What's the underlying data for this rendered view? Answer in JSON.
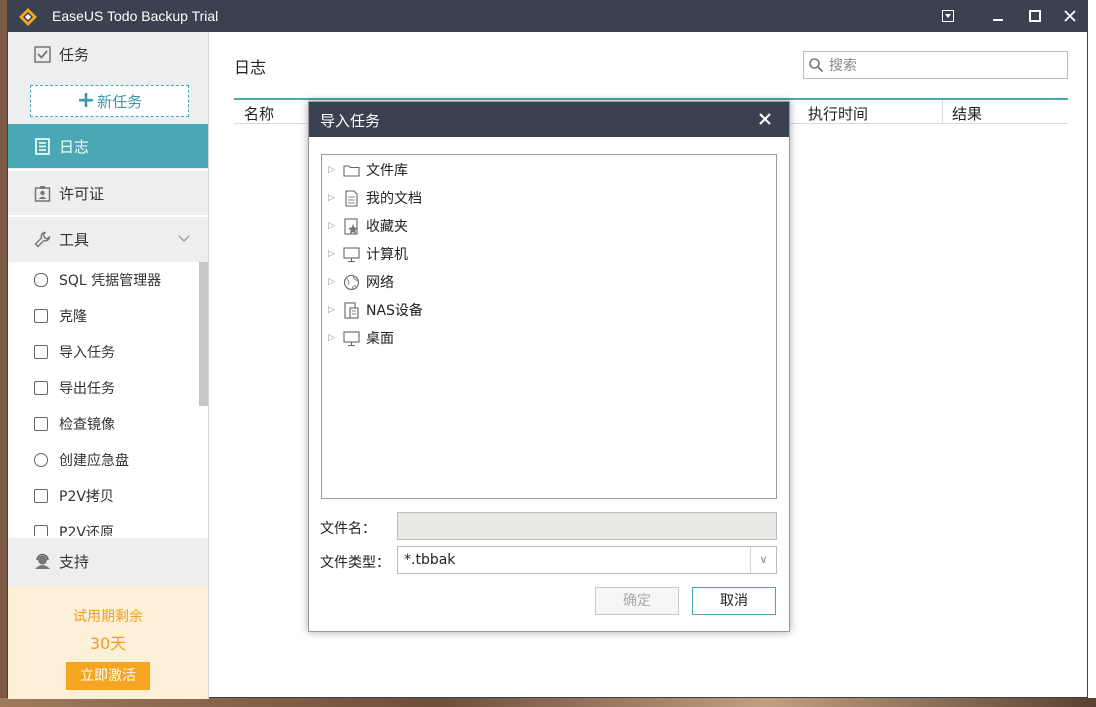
{
  "window": {
    "title": "EaseUS Todo Backup Trial"
  },
  "sidebar": {
    "tasks_label": "任务",
    "new_task_label": "新任务",
    "log_label": "日志",
    "license_label": "许可证",
    "tools_label": "工具",
    "tools": [
      {
        "label": "SQL 凭据管理器"
      },
      {
        "label": "克隆"
      },
      {
        "label": "导入任务"
      },
      {
        "label": "导出任务"
      },
      {
        "label": "检查镜像"
      },
      {
        "label": "创建应急盘"
      },
      {
        "label": "P2V拷贝"
      },
      {
        "label": "P2V还原"
      }
    ],
    "support_label": "支持",
    "trial": {
      "line1": "试用期剩余",
      "days": "30天",
      "activate_label": "立即激活"
    }
  },
  "main": {
    "title": "日志",
    "search_placeholder": "搜索",
    "columns": [
      "名称",
      "执行时间",
      "结果"
    ]
  },
  "dialog": {
    "title": "导入任务",
    "tree": [
      {
        "label": "文件库",
        "icon": "folder-icon"
      },
      {
        "label": "我的文档",
        "icon": "document-icon"
      },
      {
        "label": "收藏夹",
        "icon": "favorites-icon"
      },
      {
        "label": "计算机",
        "icon": "computer-icon"
      },
      {
        "label": "网络",
        "icon": "network-icon"
      },
      {
        "label": "NAS设备",
        "icon": "nas-icon"
      },
      {
        "label": "桌面",
        "icon": "desktop-icon"
      }
    ],
    "filename_label": "文件名：",
    "filename_value": "",
    "filetype_label": "文件类型：",
    "filetype_value": "*.tbbak",
    "ok_label": "确定",
    "cancel_label": "取消"
  },
  "colors": {
    "accent": "#4aa8b4",
    "titlebar": "#3a4150",
    "trial_orange": "#f5a51f"
  }
}
